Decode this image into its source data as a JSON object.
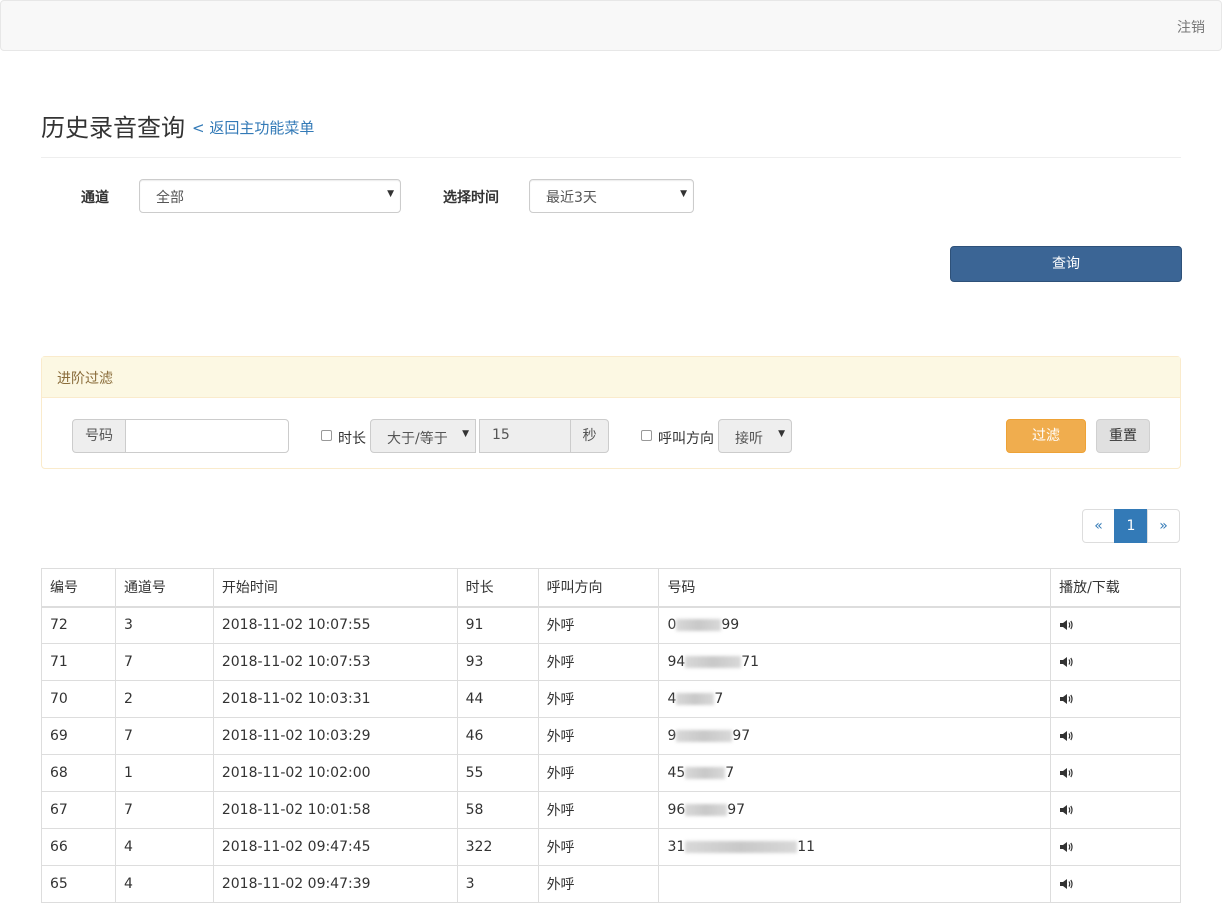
{
  "navbar": {
    "logout_label": "注销"
  },
  "header": {
    "title": "历史录音查询",
    "back_link": "< 返回主功能菜单"
  },
  "filters": {
    "channel_label": "通道",
    "channel_value": "全部",
    "time_label": "选择时间",
    "time_value": "最近3天",
    "query_button": "查询"
  },
  "advanced": {
    "heading": "进阶过滤",
    "number_addon": "号码",
    "number_value": "",
    "duration_label": "时长",
    "duration_operator": "大于/等于",
    "duration_value": "15",
    "duration_unit": "秒",
    "direction_label": "呼叫方向",
    "direction_value": "接听",
    "filter_button": "过滤",
    "reset_button": "重置"
  },
  "pagination": {
    "prev": "«",
    "current": "1",
    "next": "»"
  },
  "table": {
    "headers": [
      "编号",
      "通道号",
      "开始时间",
      "时长",
      "呼叫方向",
      "号码",
      "播放/下载"
    ],
    "rows": [
      {
        "id": "72",
        "channel": "3",
        "start": "2018-11-02 10:07:55",
        "duration": "91",
        "direction": "外呼",
        "num_prefix": "0",
        "num_suffix": "99"
      },
      {
        "id": "71",
        "channel": "7",
        "start": "2018-11-02 10:07:53",
        "duration": "93",
        "direction": "外呼",
        "num_prefix": "94",
        "num_suffix": "71"
      },
      {
        "id": "70",
        "channel": "2",
        "start": "2018-11-02 10:03:31",
        "duration": "44",
        "direction": "外呼",
        "num_prefix": "4",
        "num_suffix": "7"
      },
      {
        "id": "69",
        "channel": "7",
        "start": "2018-11-02 10:03:29",
        "duration": "46",
        "direction": "外呼",
        "num_prefix": "9",
        "num_suffix": "97"
      },
      {
        "id": "68",
        "channel": "1",
        "start": "2018-11-02 10:02:00",
        "duration": "55",
        "direction": "外呼",
        "num_prefix": "45",
        "num_suffix": "7"
      },
      {
        "id": "67",
        "channel": "7",
        "start": "2018-11-02 10:01:58",
        "duration": "58",
        "direction": "外呼",
        "num_prefix": "96",
        "num_suffix": "97"
      },
      {
        "id": "66",
        "channel": "4",
        "start": "2018-11-02 09:47:45",
        "duration": "322",
        "direction": "外呼",
        "num_prefix": "31",
        "num_suffix": "11"
      },
      {
        "id": "65",
        "channel": "4",
        "start": "2018-11-02 09:47:39",
        "duration": "3",
        "direction": "外呼",
        "num_prefix": "",
        "num_suffix": ""
      }
    ]
  }
}
